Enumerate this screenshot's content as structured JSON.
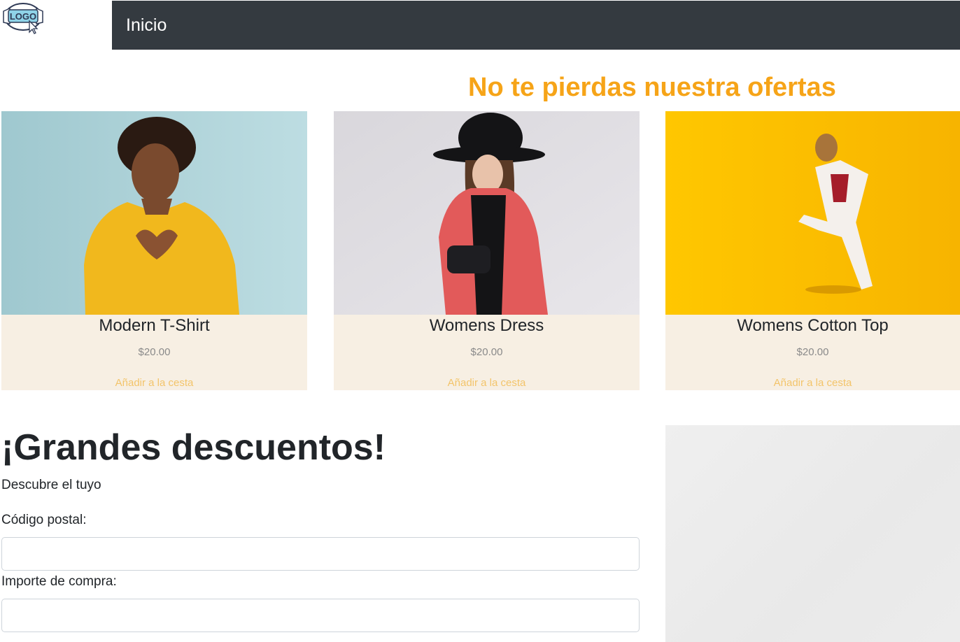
{
  "header": {
    "logo_text": "LOGO",
    "nav_link": "Inicio"
  },
  "promo": {
    "title": "No te pierdas nuestra ofertas"
  },
  "products": [
    {
      "name": "Modern T-Shirt",
      "price": "$20.00",
      "action": "Añadir a la cesta"
    },
    {
      "name": "Womens Dress",
      "price": "$20.00",
      "action": "Añadir a la cesta"
    },
    {
      "name": "Womens Cotton Top",
      "price": "$20.00",
      "action": "Añadir a la cesta"
    }
  ],
  "discounts": {
    "title": "¡Grandes descuentos!",
    "subtitle": "Descubre el tuyo",
    "postal_label": "Código postal:",
    "postal_value": "",
    "amount_label": "Importe de compra:",
    "amount_value": ""
  },
  "colors": {
    "navbar": "#343a40",
    "accent": "#f6a418",
    "card_bg": "#f7efe3",
    "add_link": "#f3c46a"
  }
}
